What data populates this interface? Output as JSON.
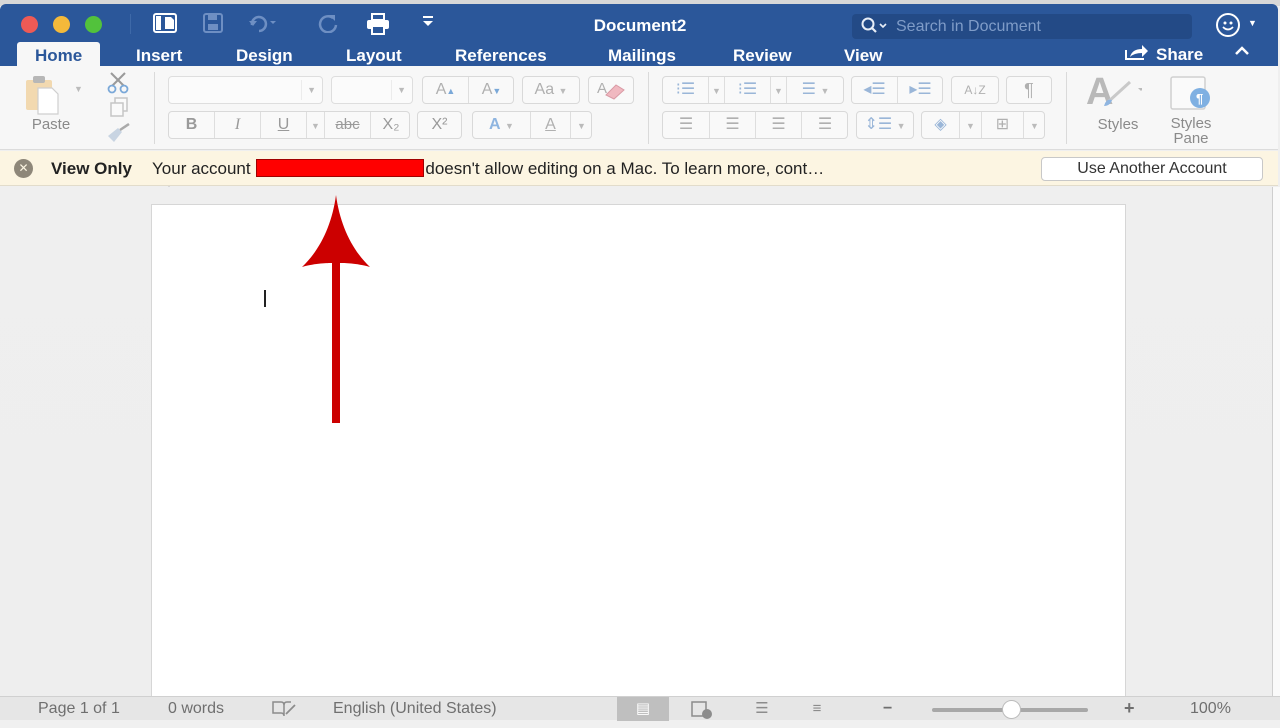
{
  "window": {
    "title": "Document2",
    "traffic_lights": [
      "close",
      "minimize",
      "zoom"
    ]
  },
  "quick_access": {
    "icons": [
      "sidebar-icon",
      "save-icon",
      "undo-icon",
      "redo-icon",
      "print-icon",
      "customize-icon"
    ]
  },
  "search": {
    "placeholder": "Search in Document",
    "value": ""
  },
  "tabs": [
    {
      "label": "Home",
      "active": true
    },
    {
      "label": "Insert",
      "active": false
    },
    {
      "label": "Design",
      "active": false
    },
    {
      "label": "Layout",
      "active": false
    },
    {
      "label": "References",
      "active": false
    },
    {
      "label": "Mailings",
      "active": false
    },
    {
      "label": "Review",
      "active": false
    },
    {
      "label": "View",
      "active": false
    }
  ],
  "share": {
    "label": "Share"
  },
  "ribbon": {
    "paste_label": "Paste",
    "font_name": "",
    "font_size": "",
    "format_buttons": {
      "bold": "B",
      "italic": "I",
      "underline": "U",
      "strikethrough": "abc",
      "subscript": "X₂",
      "superscript": "X²"
    },
    "styles_label": "Styles",
    "styles_pane_label_1": "Styles",
    "styles_pane_label_2": "Pane"
  },
  "infobar": {
    "title": "View Only",
    "message_prefix": "Your account",
    "message_suffix": "doesn't allow editing on a Mac. To learn more, cont…",
    "button_label": "Use Another Account"
  },
  "status": {
    "page": "Page 1 of 1",
    "words": "0 words",
    "language": "English (United States)",
    "zoom_level": "100%",
    "zoom_percent": 100
  },
  "colors": {
    "titlebar": "#2b579a",
    "infobar_bg": "#fcf5e2",
    "annotation_arrow": "#cc0000",
    "redaction": "#ff0000"
  }
}
